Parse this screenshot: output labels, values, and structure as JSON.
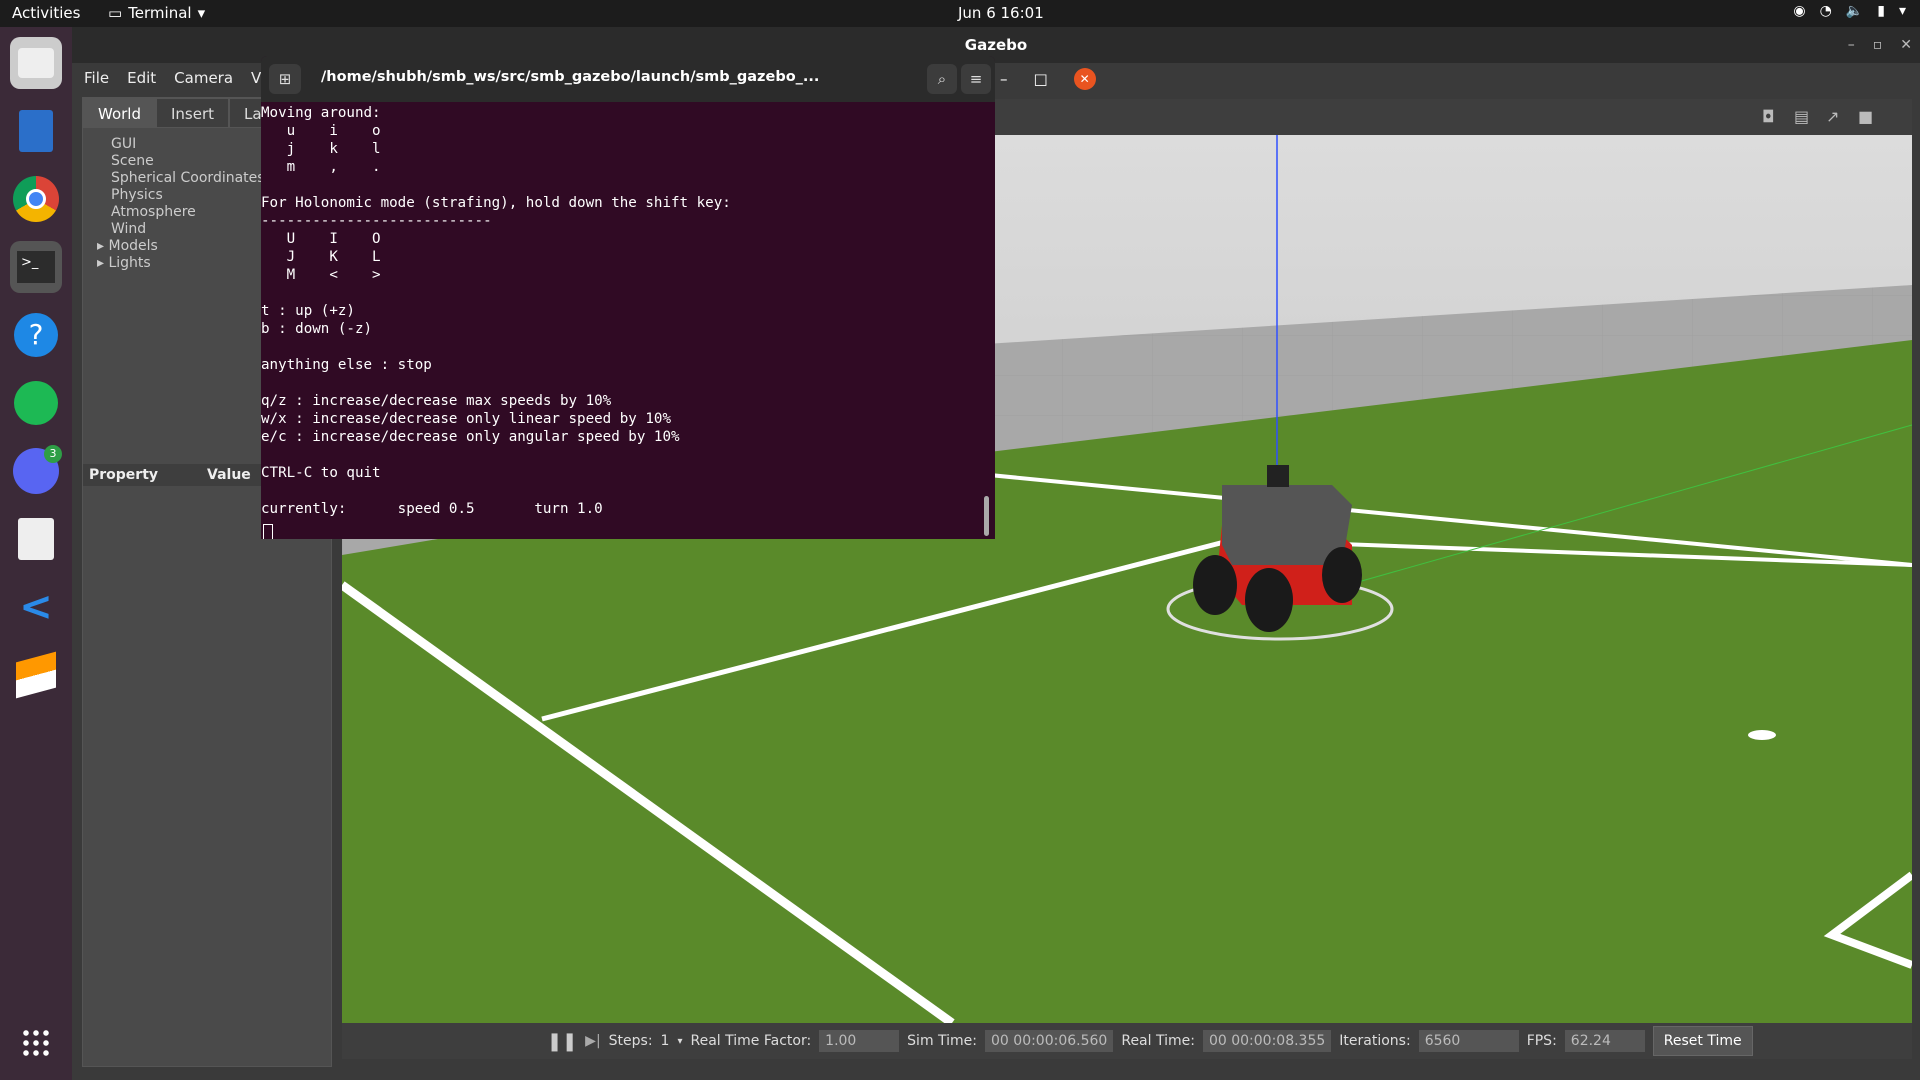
{
  "topbar": {
    "activities": "Activities",
    "app": "Terminal",
    "clock": "Jun 6  16:01"
  },
  "gazebo": {
    "title": "Gazebo",
    "menu": [
      "File",
      "Edit",
      "Camera",
      "Vi"
    ],
    "tabs": [
      "World",
      "Insert",
      "La"
    ],
    "tree": [
      "GUI",
      "Scene",
      "Spherical Coordinates",
      "Physics",
      "Atmosphere",
      "Wind",
      "Models",
      "Lights"
    ],
    "prop_header": [
      "Property",
      "Value"
    ],
    "bottom": {
      "steps_label": "Steps:",
      "steps_value": "1",
      "rtf_label": "Real Time Factor:",
      "rtf": "1.00",
      "sim_label": "Sim Time:",
      "sim": "00 00:00:06.560",
      "real_label": "Real Time:",
      "real": "00 00:00:08.355",
      "iter_label": "Iterations:",
      "iter": "6560",
      "fps_label": "FPS:",
      "fps": "62.24",
      "reset": "Reset Time"
    }
  },
  "terminal": {
    "path": "/home/shubh/smb_ws/src/smb_gazebo/launch/smb_gazebo_...",
    "text": "Moving around:\n   u    i    o\n   j    k    l\n   m    ,    .\n\nFor Holonomic mode (strafing), hold down the shift key:\n---------------------------\n   U    I    O\n   J    K    L\n   M    <    >\n\nt : up (+z)\nb : down (-z)\n\nanything else : stop\n\nq/z : increase/decrease max speeds by 10%\nw/x : increase/decrease only linear speed by 10%\ne/c : increase/decrease only angular speed by 10%\n\nCTRL-C to quit\n\ncurrently:      speed 0.5       turn 1.0"
  },
  "dock": {
    "discord_badge": "3"
  },
  "colors": {
    "terminal_bg": "#300a24",
    "grass": "#5a8a2a",
    "close": "#e95420"
  }
}
